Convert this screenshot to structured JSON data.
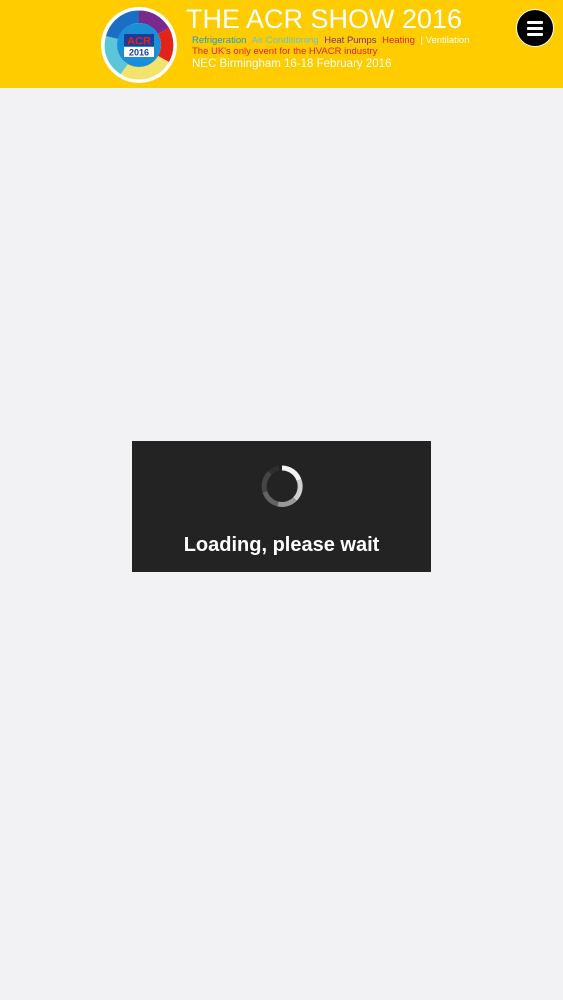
{
  "header": {
    "title": "THE ACR SHOW 2016",
    "topics": [
      {
        "label": "Refrigeration",
        "color": "#1a9bd7"
      },
      {
        "label": "Air Conditioning",
        "color": "#5cc6d8"
      },
      {
        "label": "Heat Pumps",
        "color": "#7a2a8c"
      },
      {
        "label": "Heating",
        "color": "#e2231a"
      },
      {
        "label": "| Ventilation",
        "color": "#ffffff"
      }
    ],
    "tagline": "The UK's only event for the HVACR industry",
    "venue": "NEC Birmingham 16-18 February 2016",
    "logo": {
      "text": "ACR",
      "year": "2016"
    }
  },
  "menu": {
    "icon": "hamburger-menu-icon"
  },
  "loading": {
    "message": "Loading, please wait",
    "icon": "spinner-icon"
  },
  "colors": {
    "header_bg": "#ffcc00",
    "page_bg": "#f2f1f3",
    "loading_bg": "#232323"
  }
}
